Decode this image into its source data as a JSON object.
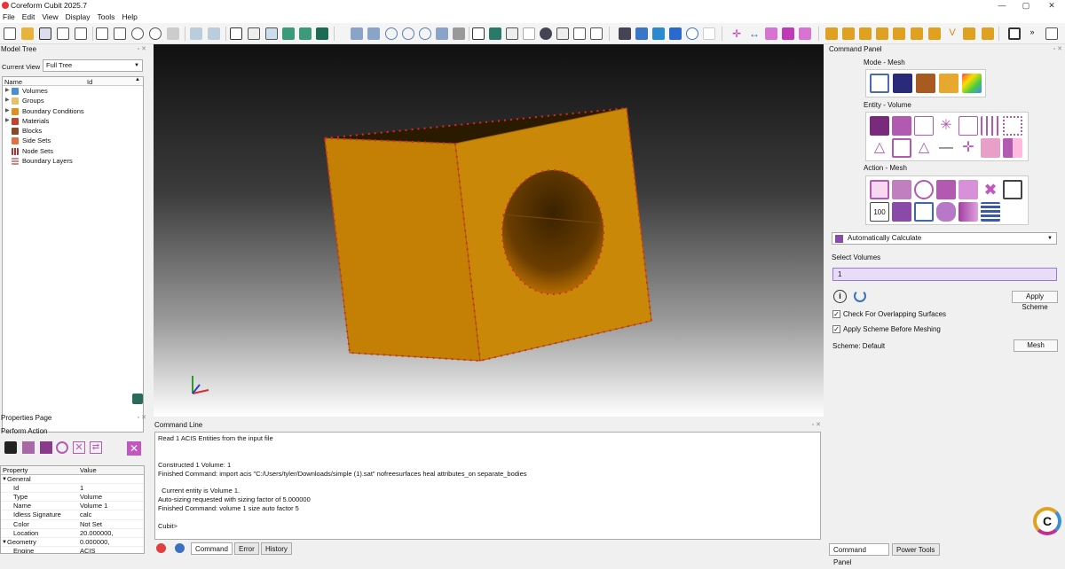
{
  "app": {
    "title": "Coreform Cubit 2025.7"
  },
  "menu": [
    "File",
    "Edit",
    "View",
    "Display",
    "Tools",
    "Help"
  ],
  "model_tree": {
    "title": "Model Tree",
    "current_view_label": "Current View",
    "current_view_value": "Full Tree",
    "columns": [
      "Name",
      "Id"
    ],
    "items": [
      "Volumes",
      "Groups",
      "Boundary Conditions",
      "Materials",
      "Blocks",
      "Side Sets",
      "Node Sets",
      "Boundary Layers"
    ]
  },
  "properties": {
    "title": "Properties Page",
    "action_label": "Perform Action",
    "columns": [
      "Property",
      "Value"
    ],
    "rows": [
      {
        "k": "General",
        "v": "",
        "group": true
      },
      {
        "k": "Id",
        "v": "1"
      },
      {
        "k": "Type",
        "v": "Volume"
      },
      {
        "k": "Name",
        "v": "Volume 1"
      },
      {
        "k": "Idless Signature",
        "v": "calc"
      },
      {
        "k": "Color",
        "v": "Not Set"
      },
      {
        "k": "Location",
        "v": "20.000000, 0.000000,"
      },
      {
        "k": "Geometry",
        "v": "",
        "group": true
      },
      {
        "k": "Engine",
        "v": "ACIS"
      }
    ]
  },
  "command_line": {
    "title": "Command Line",
    "text": "Read 1 ACIS Entities from the input file\n\n\nConstructed 1 Volume: 1\nFinished Command: import acis \"C:/Users/tyler/Downloads/simple (1).sat\" nofreesurfaces heal attributes_on separate_bodies\n\n  Current entity is Volume 1.\nAuto-sizing requested with sizing factor of 5.000000\nFinished Command: volume 1 size auto factor 5\n\nCubit>",
    "tabs": [
      "Command",
      "Error",
      "History"
    ]
  },
  "command_panel": {
    "title": "Command Panel",
    "mode_title": "Mode - Mesh",
    "entity_title": "Entity - Volume",
    "action_title": "Action - Mesh",
    "scheme_select": "Automatically Calculate",
    "select_label": "Select Volumes",
    "select_value": "1",
    "apply_scheme": "Apply Scheme",
    "check1": "Check For Overlapping Surfaces",
    "check2": "Apply Scheme Before Meshing",
    "scheme_text": "Scheme: Default",
    "mesh_button": "Mesh"
  },
  "bottom_tabs": [
    "Command Panel",
    "Power Tools"
  ],
  "colors": {
    "part": "#c98206",
    "edge_dots": "#e0262a",
    "accent": "#7a3da8"
  }
}
